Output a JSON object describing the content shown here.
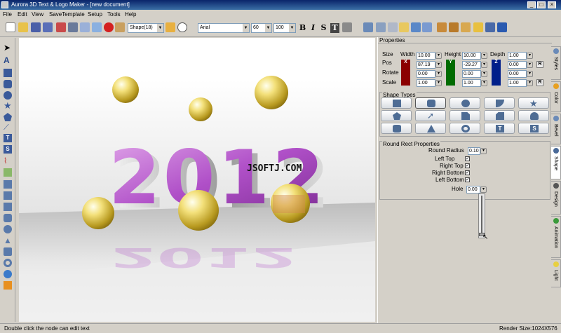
{
  "window": {
    "title": "Aurora 3D Text & Logo Maker - [new document]",
    "minimize": "_",
    "maximize": "□",
    "close": "×"
  },
  "menu": [
    "File",
    "Edit",
    "View",
    "SaveTemplate",
    "Setup",
    "Tools",
    "Help"
  ],
  "toolbar": {
    "shape_select": "Shape(18)",
    "font_select": "Arial",
    "font_size": "60",
    "font_scale": "100",
    "bold": "B",
    "italic": "I",
    "strike": "S",
    "text_t": "T"
  },
  "viewport": {
    "text": "2012",
    "watermark": "JSOFTJ.COM"
  },
  "properties": {
    "title": "Properties",
    "col_headers": {
      "size": "Size",
      "width": "Width",
      "height": "Height",
      "depth": "Depth"
    },
    "rows": [
      {
        "label": "",
        "values": [
          "10.00",
          "10.00",
          "1.00"
        ]
      },
      {
        "label": "Pos",
        "values": [
          "87.19",
          "-29.27",
          "0.00"
        ],
        "reset": "R"
      },
      {
        "label": "Rotate",
        "values": [
          "0.00",
          "0.00",
          "0.00"
        ]
      },
      {
        "label": "Scale",
        "values": [
          "1.00",
          "1.00",
          "1.00"
        ],
        "reset": "R"
      }
    ],
    "axes": [
      "X",
      "Y",
      "Z"
    ],
    "shape_types_title": "Shape Types",
    "shape_icons": [
      "square-icon",
      "round-rect-icon",
      "circle-icon",
      "quarter-circle-icon",
      "star-icon",
      "pentagon-icon",
      "arrow-icon",
      "corner-icon",
      "cut-corner-icon",
      "half-circle-icon",
      "cylinder-icon",
      "triangle-icon",
      "ring-icon",
      "t-shape-icon",
      "s-shape-icon"
    ],
    "round_rect_title": "Round Rect Properties",
    "round_radius_label": "Round Radius",
    "round_radius": "0.10",
    "checks": [
      {
        "label": "Left Top",
        "checked": "✓"
      },
      {
        "label": "Right Top",
        "checked": "✓"
      },
      {
        "label": "Right Bottom",
        "checked": "✓"
      },
      {
        "label": "Left Bottom",
        "checked": "✓"
      }
    ],
    "hole_label": "Hole",
    "hole_value": "0.00"
  },
  "side_tabs": [
    "Styles",
    "Color",
    "Bevel",
    "Shape",
    "Design",
    "Animation",
    "Light"
  ],
  "status": {
    "left": "Double click the node can edit text",
    "right": "Render Size:1024X576"
  },
  "colors": {
    "titlebar": "#0a246a",
    "x_axis": "#8b0000",
    "y_axis": "#006b00",
    "z_axis": "#001f8a",
    "text3d": "#b45fc4",
    "balls": "#e8d84a"
  }
}
